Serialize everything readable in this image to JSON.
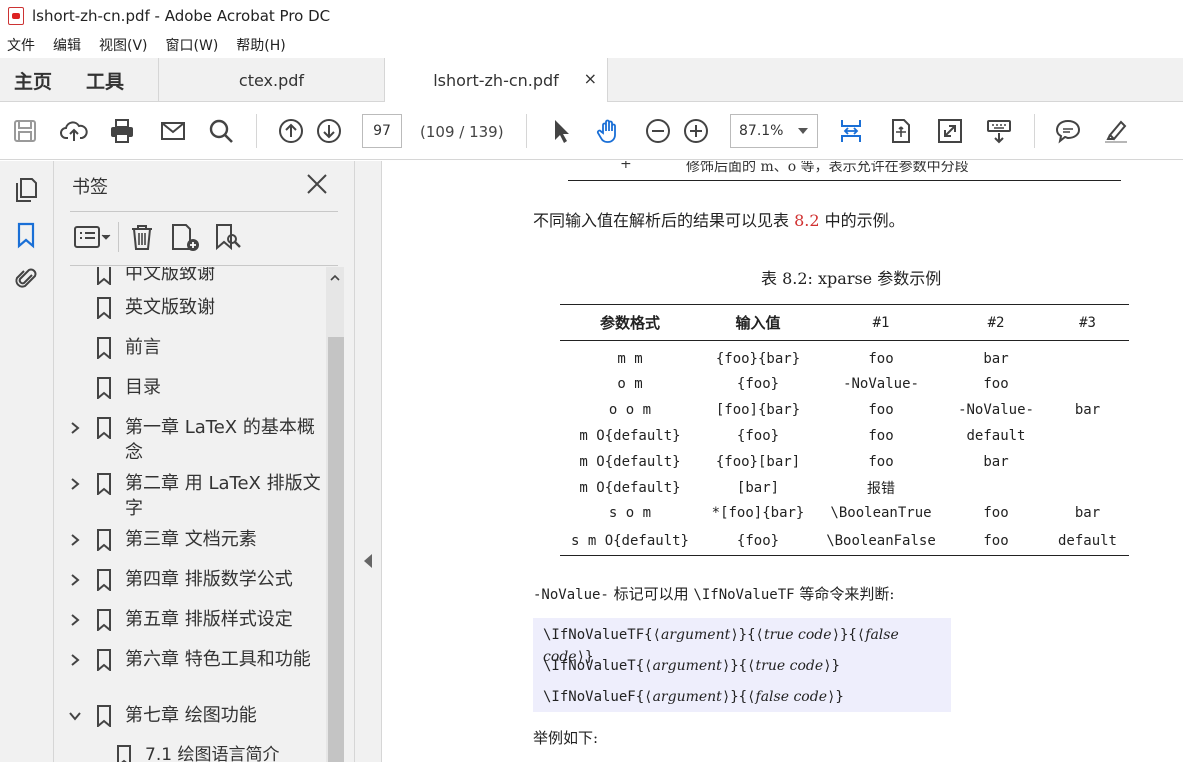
{
  "window": {
    "title": "lshort-zh-cn.pdf - Adobe Acrobat Pro DC"
  },
  "menu": [
    "文件",
    "编辑",
    "视图(V)",
    "窗口(W)",
    "帮助(H)"
  ],
  "tabs": {
    "home": "主页",
    "tools": "工具",
    "doc1": "ctex.pdf",
    "doc2": "lshort-zh-cn.pdf",
    "close": "×"
  },
  "toolbar": {
    "page": "97",
    "page_count": "(109 / 139)",
    "zoom": "87.1%"
  },
  "bookmarks": {
    "title": "书签",
    "items": [
      {
        "label": "中文版致谢",
        "chevron": false
      },
      {
        "label": "英文版致谢",
        "chevron": false
      },
      {
        "label": "前言",
        "chevron": false
      },
      {
        "label": "目录",
        "chevron": false
      },
      {
        "label": "第一章  LaTeX 的基本概念",
        "chevron": "right"
      },
      {
        "label": "第二章  用 LaTeX 排版文字",
        "chevron": "right"
      },
      {
        "label": "第三章  文档元素",
        "chevron": "right"
      },
      {
        "label": "第四章  排版数学公式",
        "chevron": "right"
      },
      {
        "label": "第五章  排版样式设定",
        "chevron": "right"
      },
      {
        "label": "第六章  特色工具和功能",
        "chevron": "right"
      },
      {
        "label": "第七章  绘图功能",
        "chevron": "down"
      },
      {
        "label": "7.1 绘图语言简介",
        "chevron": false
      }
    ]
  },
  "doc": {
    "top_row_plus": "+",
    "top_row_desc": "修饰后面的 m、o 等，表示允许在参数中分段",
    "para1_pre": "不同输入值在解析后的结果可以见表 ",
    "para1_ref": "8.2",
    "para1_post": " 中的示例。",
    "caption": "表 8.2: xparse 参数示例",
    "table": {
      "headers": [
        "参数格式",
        "输入值",
        "#1",
        "#2",
        "#3"
      ],
      "rows": [
        [
          "m m",
          "{foo}{bar}",
          "foo",
          "bar",
          ""
        ],
        [
          "o m",
          "{foo}",
          "-NoValue-",
          "foo",
          ""
        ],
        [
          "o o m",
          "[foo]{bar}",
          "foo",
          "-NoValue-",
          "bar"
        ],
        [
          "m O{default}",
          "{foo}",
          "foo",
          "default",
          ""
        ],
        [
          "m O{default}",
          "{foo}[bar]",
          "foo",
          "bar",
          ""
        ],
        [
          "m O{default}",
          "[bar]",
          "报错",
          "",
          ""
        ],
        [
          "s o m",
          "*[foo]{bar}",
          "\\BooleanTrue",
          "foo",
          "bar"
        ],
        [
          "s m O{default}",
          "{foo}",
          "\\BooleanFalse",
          "foo",
          "default"
        ]
      ]
    },
    "para2_a": "-NoValue-",
    "para2_b": " 标记可以用 ",
    "para2_c": "\\IfNoValueTF",
    "para2_d": " 等命令来判断:",
    "code": [
      {
        "cmd": "\\IfNoValueTF",
        "args": [
          "argument",
          "true code",
          "false code"
        ]
      },
      {
        "cmd": "\\IfNoValueT",
        "args": [
          "argument",
          "true code"
        ]
      },
      {
        "cmd": "\\IfNoValueF",
        "args": [
          "argument",
          "false code"
        ]
      }
    ],
    "para3": "举例如下:"
  },
  "colors": {
    "accent": "#1a6fd6",
    "ref": "#d03030",
    "code_bg": "#eeeefc"
  }
}
